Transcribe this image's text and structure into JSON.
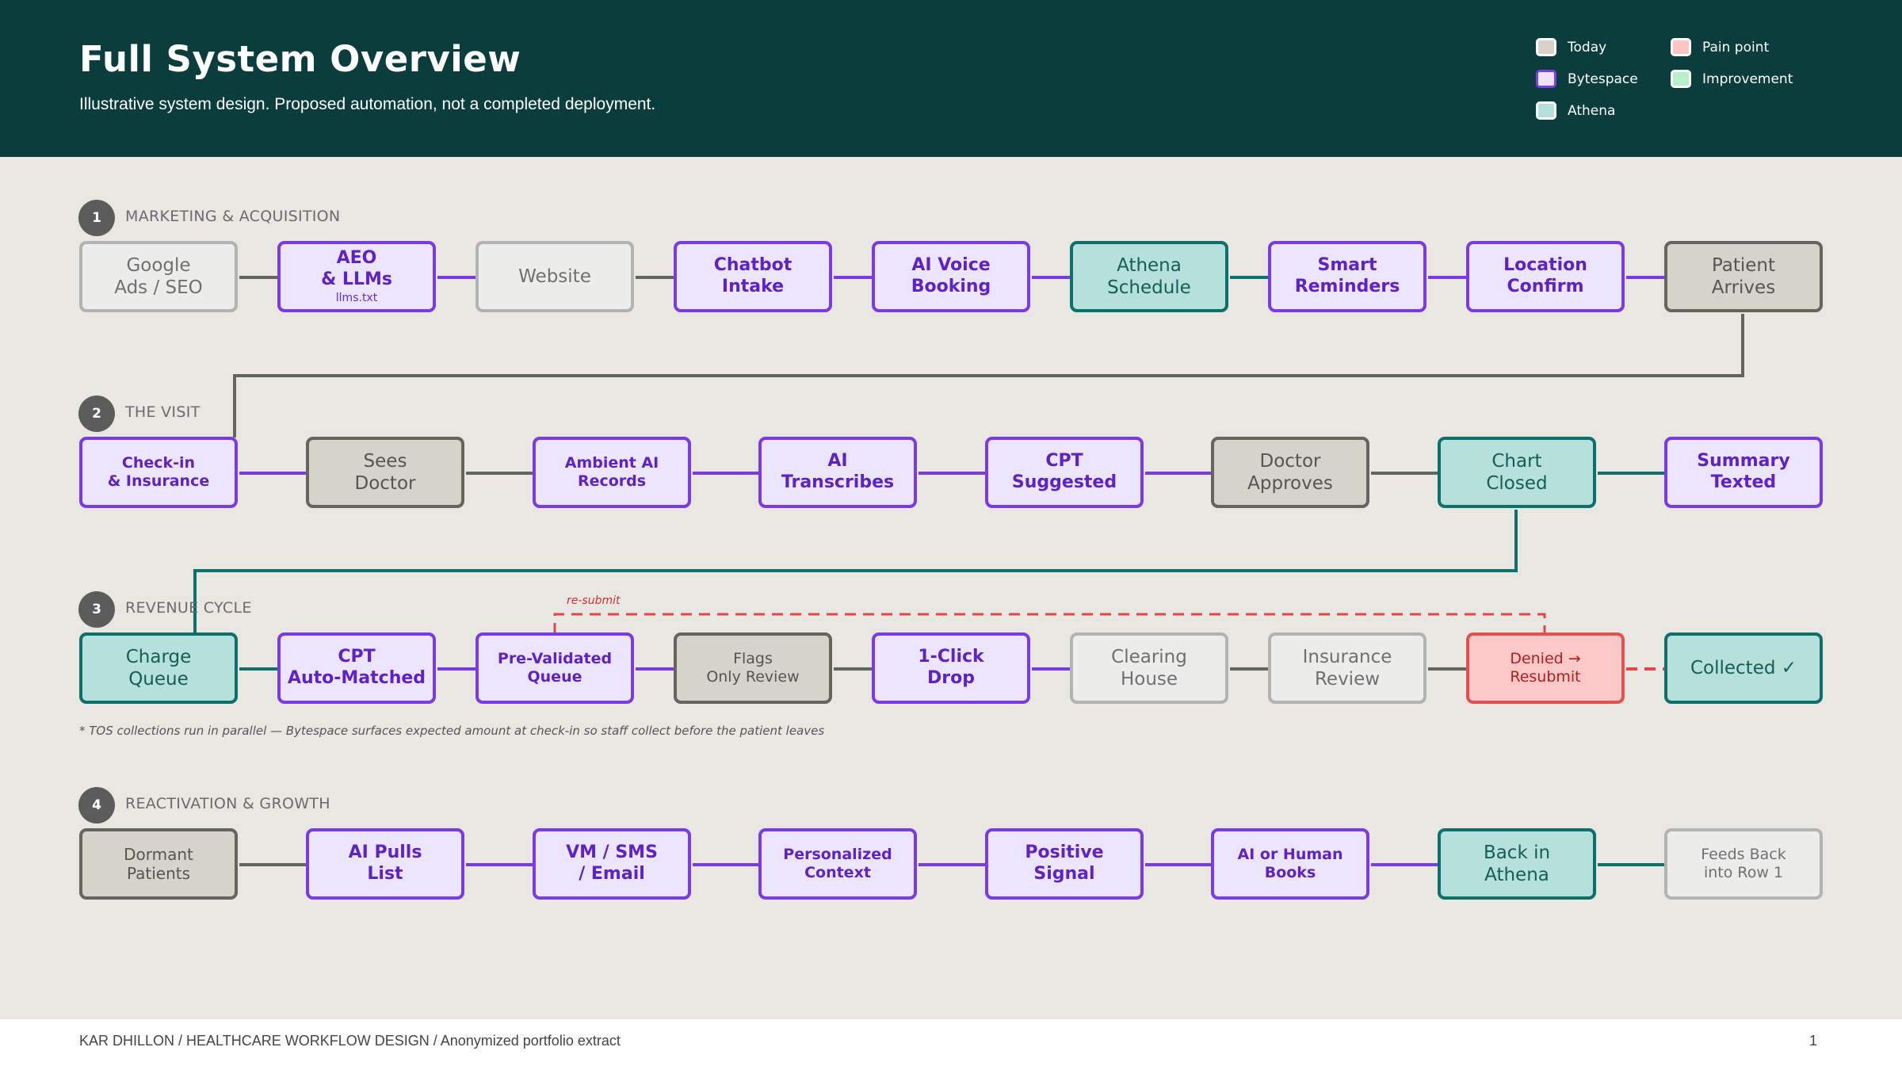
{
  "header": {
    "title": "Full System Overview",
    "subtitle": "Illustrative system design. Proposed automation, not a completed deployment."
  },
  "legend": [
    {
      "label": "Today",
      "color": "#d7d3c9"
    },
    {
      "label": "Pain point",
      "color": "#fdc5c5"
    },
    {
      "label": "Bytespace",
      "color": "#ebe3ff"
    },
    {
      "label": "Improvement",
      "color": "#b8f0cc"
    },
    {
      "label": "Athena",
      "color": "#b6e0da"
    }
  ],
  "sections": [
    {
      "number": "1",
      "label": "MARKETING & ACQUISITION",
      "nodes": [
        {
          "text": "Google\nAds / SEO",
          "kind": "web"
        },
        {
          "text": "AEO\n& LLMs",
          "sub": "llms.txt",
          "kind": "bytespace"
        },
        {
          "text": "Website",
          "kind": "web"
        },
        {
          "text": "Chatbot\nIntake",
          "kind": "bytespace"
        },
        {
          "text": "AI Voice\nBooking",
          "kind": "bytespace"
        },
        {
          "text": "Athena\nSchedule",
          "kind": "athena"
        },
        {
          "text": "Smart\nReminders",
          "kind": "bytespace"
        },
        {
          "text": "Location\nConfirm",
          "kind": "bytespace"
        },
        {
          "text": "Patient\nArrives",
          "kind": "today"
        }
      ]
    },
    {
      "number": "2",
      "label": "THE VISIT",
      "nodes": [
        {
          "text": "Check-in\n& Insurance",
          "kind": "bytespace"
        },
        {
          "text": "Sees\nDoctor",
          "kind": "today"
        },
        {
          "text": "Ambient AI\nRecords",
          "kind": "bytespace"
        },
        {
          "text": "AI\nTranscribes",
          "kind": "bytespace"
        },
        {
          "text": "CPT\nSuggested",
          "kind": "bytespace"
        },
        {
          "text": "Doctor\nApproves",
          "kind": "today"
        },
        {
          "text": "Chart\nClosed",
          "kind": "athena"
        },
        {
          "text": "Summary\nTexted",
          "kind": "bytespace"
        }
      ]
    },
    {
      "number": "3",
      "label": "REVENUE CYCLE",
      "resubmit_label": "re-submit",
      "footnote": "* TOS collections run in parallel — Bytespace surfaces expected amount at check-in so staff collect before the patient leaves",
      "nodes": [
        {
          "text": "Charge\nQueue",
          "kind": "athena"
        },
        {
          "text": "CPT\nAuto-Matched",
          "kind": "bytespace"
        },
        {
          "text": "Pre-Validated\nQueue",
          "kind": "bytespace"
        },
        {
          "text": "Flags\nOnly Review",
          "kind": "today"
        },
        {
          "text": "1-Click\nDrop",
          "kind": "bytespace"
        },
        {
          "text": "Clearing\nHouse",
          "kind": "web"
        },
        {
          "text": "Insurance\nReview",
          "kind": "web"
        },
        {
          "text": "Denied →\nResubmit",
          "kind": "pain"
        },
        {
          "text": "Collected ✓",
          "kind": "athena"
        }
      ]
    },
    {
      "number": "4",
      "label": "REACTIVATION & GROWTH",
      "nodes": [
        {
          "text": "Dormant\nPatients",
          "kind": "today"
        },
        {
          "text": "AI Pulls\nList",
          "kind": "bytespace"
        },
        {
          "text": "VM / SMS\n/ Email",
          "kind": "bytespace"
        },
        {
          "text": "Personalized\nContext",
          "kind": "bytespace"
        },
        {
          "text": "Positive\nSignal",
          "kind": "bytespace"
        },
        {
          "text": "AI or Human\nBooks",
          "kind": "bytespace"
        },
        {
          "text": "Back in\nAthena",
          "kind": "athena"
        },
        {
          "text": "Feeds Back\ninto Row 1",
          "kind": "web"
        }
      ]
    }
  ],
  "footer": {
    "text": "KAR DHILLON / HEALTHCARE WORKFLOW DESIGN / Anonymized portfolio extract",
    "page": "1"
  }
}
